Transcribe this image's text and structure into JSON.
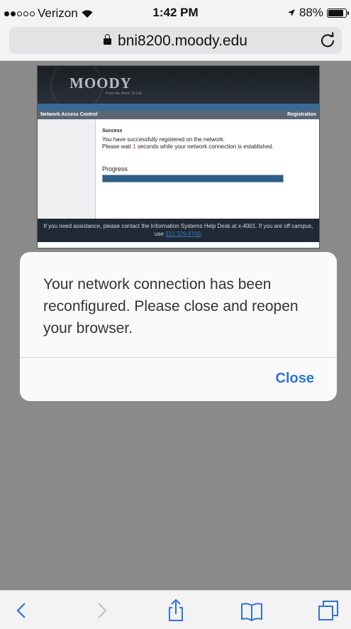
{
  "status_bar": {
    "carrier": "Verizon",
    "time": "1:42 PM",
    "battery": "88%",
    "battery_level": 0.88,
    "signal_bars_filled": 2,
    "signal_bars_total": 5
  },
  "address_bar": {
    "url": "bni8200.moody.edu"
  },
  "web_page": {
    "logo": "MOODY",
    "logo_tagline": "From the Word. To Life.",
    "nav_left": "Network Access Control",
    "nav_right": "Registration",
    "success_title": "Success",
    "message_line1": "You have successfully registered on the network.",
    "message_prefix": "Please wait",
    "countdown": "1",
    "message_suffix": "seconds while your network connection is established.",
    "progress_label": "Progress",
    "progress_value": 1.0,
    "footer_text": "If you need assistance, please contact the Information Systems Help Desk at x-4001. If you are off campus, use",
    "footer_link": "321-329-8700",
    "footer_end": "."
  },
  "alert": {
    "message": "Your network connection has been reconfigured. Please close and reopen your browser.",
    "close_label": "Close"
  },
  "toolbar": {
    "icons": [
      "back-icon",
      "forward-icon",
      "share-icon",
      "bookmarks-icon",
      "tabs-icon"
    ]
  },
  "colors": {
    "accent": "#2f74d6",
    "countdown": "#c3262b",
    "progress_fill": "#2f5f87",
    "overlay": "#8a8a8a"
  }
}
